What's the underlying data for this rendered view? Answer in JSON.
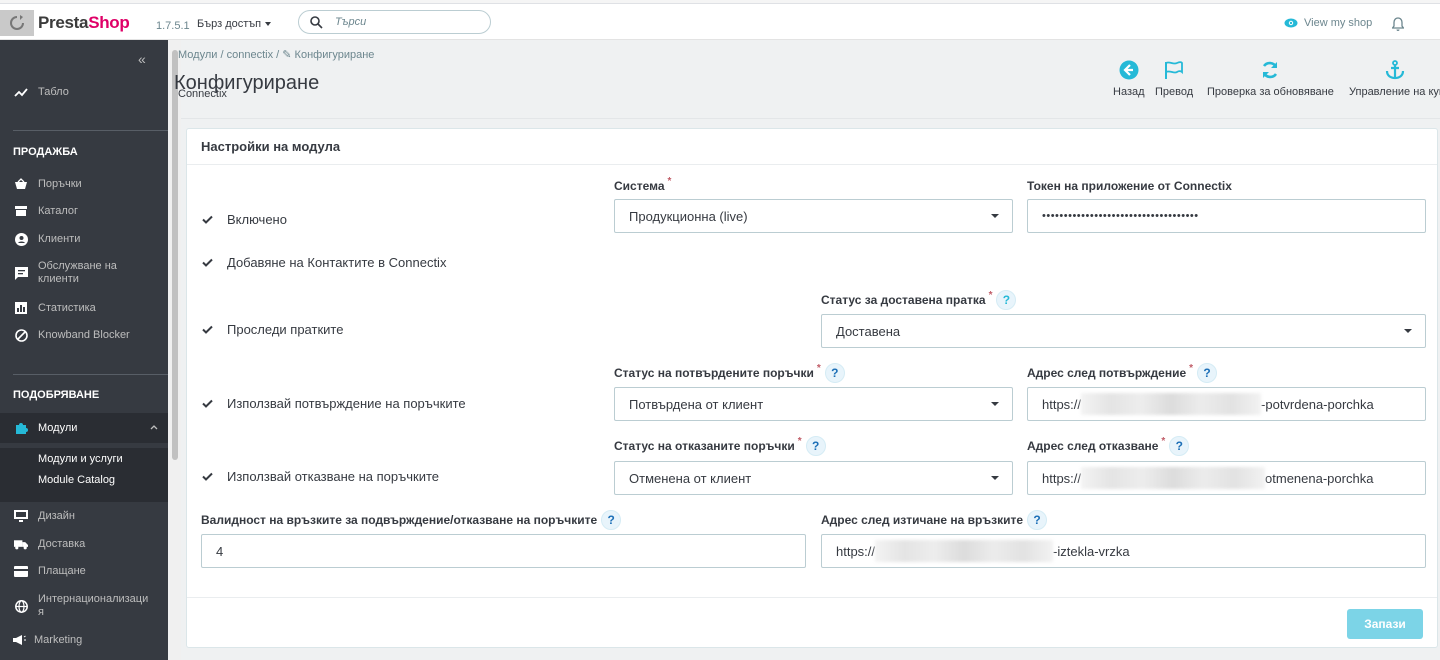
{
  "header": {
    "brand": "PrestaShop",
    "version": "1.7.5.1",
    "quick_access": "Бърз достъп",
    "search_placeholder": "Търси",
    "view_shop": "View my shop",
    "brand_color": "#df0067"
  },
  "sidebar": {
    "collapse": "«",
    "dashboard": "Табло",
    "sections": {
      "sell": "ПРОДАЖБА",
      "improve": "ПОДОБРЯВАНЕ"
    },
    "sell_items": [
      {
        "label": "Поръчки",
        "icon": "basket-icon"
      },
      {
        "label": "Каталог",
        "icon": "store-icon"
      },
      {
        "label": "Клиенти",
        "icon": "account-icon"
      },
      {
        "label": "Обслужване на клиенти",
        "icon": "chat-icon"
      },
      {
        "label": "Статистика",
        "icon": "stats-icon"
      },
      {
        "label": "Knowband Blocker",
        "icon": "block-icon"
      }
    ],
    "modules": "Модули",
    "modules_sub": [
      "Модули и услуги",
      "Module Catalog"
    ],
    "improve_items": [
      {
        "label": "Дизайн",
        "icon": "desktop-icon"
      },
      {
        "label": "Доставка",
        "icon": "truck-icon"
      },
      {
        "label": "Плащане",
        "icon": "card-icon"
      },
      {
        "label": "Интернационализация",
        "icon": "globe-icon"
      },
      {
        "label": "Marketing",
        "icon": "megaphone-icon"
      }
    ]
  },
  "page": {
    "breadcrumb": [
      "Модули",
      "connectix",
      "Конфигуриране"
    ],
    "title": "Конфигуриране",
    "subtitle": "Connectix",
    "toolbar": [
      {
        "label": "Назад",
        "icon": "arrow-left-circle-icon"
      },
      {
        "label": "Превод",
        "icon": "flag-icon"
      },
      {
        "label": "Проверка за обновяване",
        "icon": "refresh-icon"
      },
      {
        "label": "Управление на куки",
        "icon": "anchor-icon"
      }
    ]
  },
  "form": {
    "panel_title": "Настройки на модула",
    "checkboxes": [
      {
        "label": "Включено",
        "checked": true
      },
      {
        "label": "Добавяне на Контактите в Connectix",
        "checked": true
      },
      {
        "label": "Проследи пратките",
        "checked": true
      },
      {
        "label": "Използвай потвърждение на поръчките",
        "checked": true
      },
      {
        "label": "Използвай отказване на поръчките",
        "checked": true
      }
    ],
    "system_label": "Система",
    "system_value": "Продукционна (live)",
    "token_label": "Токен на приложение от Connectix",
    "token_value": "••••••••••••••••••••••••••••••••••••",
    "delivered_label": "Статус за доставена пратка",
    "delivered_value": "Доставена",
    "confirmed_label": "Статус на потвърдените поръчки",
    "confirmed_value": "Потвърдена от клиент",
    "after_confirm_label": "Адрес след потвърждение",
    "after_confirm_prefix": "https://",
    "after_confirm_suffix": "-potvrdena-porchka",
    "cancelled_label": "Статус на отказаните поръчки",
    "cancelled_value": "Отменена от клиент",
    "after_cancel_label": "Адрес след отказване",
    "after_cancel_prefix": "https://",
    "after_cancel_suffix": "otmenena-porchka",
    "validity_label": "Валидност на връзките за подвърждение/отказване на поръчките",
    "validity_value": "4",
    "after_expire_label": "Адрес след изтичане на връзките",
    "after_expire_prefix": "https://",
    "after_expire_suffix": "-iztekla-vrzka",
    "help": "?",
    "required": "*",
    "save": "Запази",
    "accent_color": "#25b9d7"
  }
}
